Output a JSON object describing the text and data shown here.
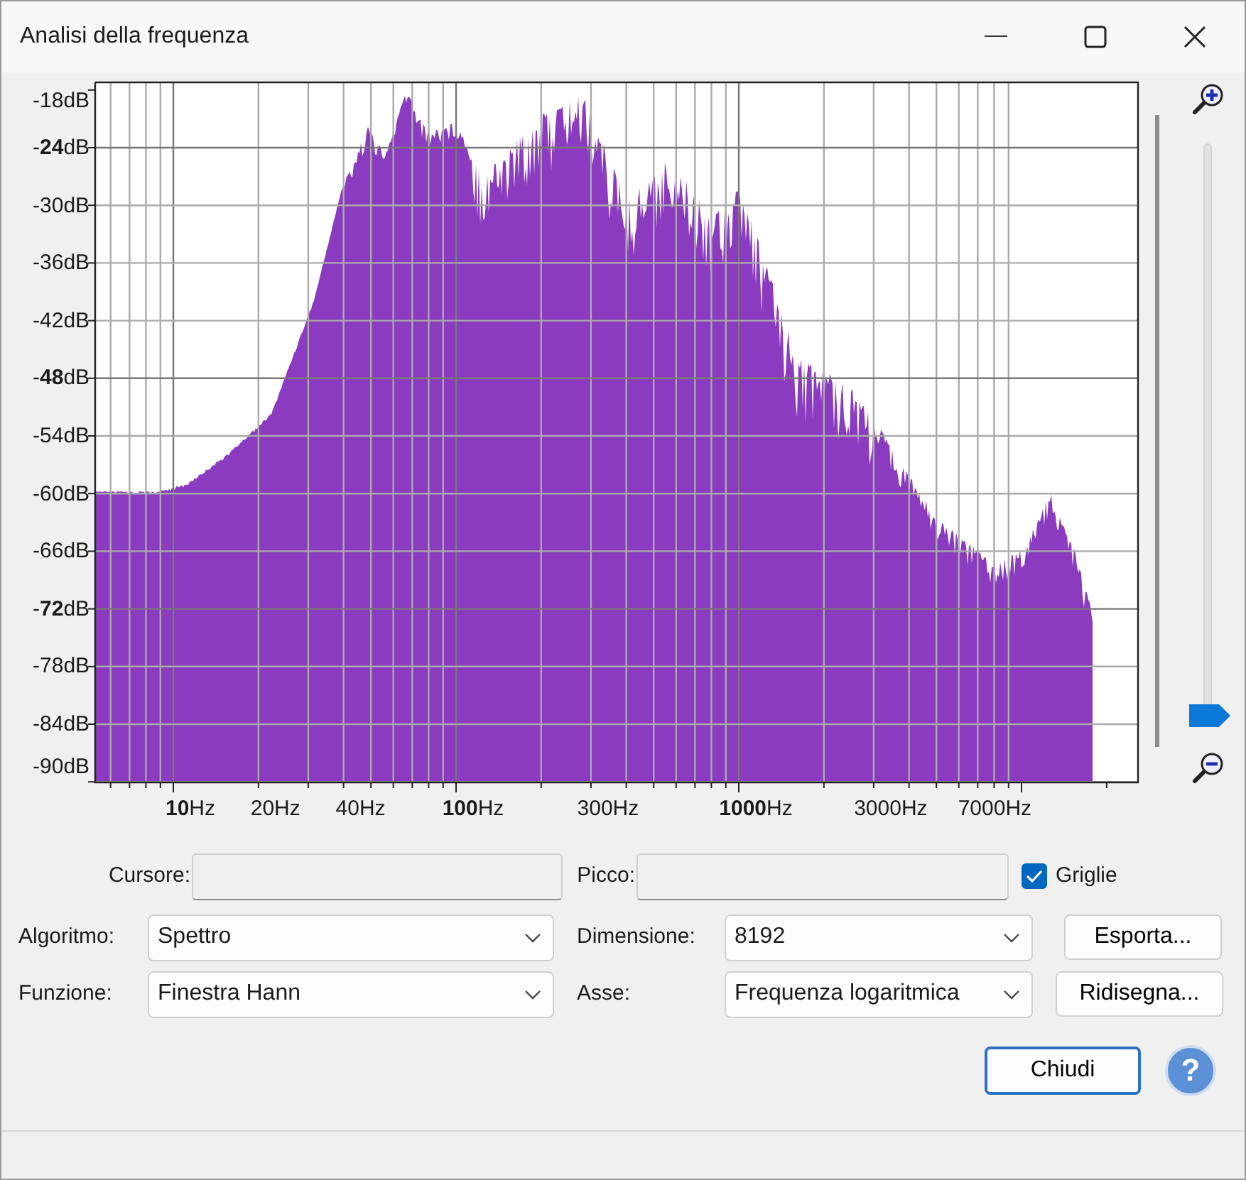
{
  "window": {
    "title": "Analisi della frequenza"
  },
  "spectrum": {
    "y_labels": [
      "-18dB",
      "-**24**dB",
      "-30dB",
      "-36dB",
      "-42dB",
      "-**48**dB",
      "-54dB",
      "-60dB",
      "-66dB",
      "-**72**dB",
      "-78dB",
      "-84dB",
      "-90dB"
    ],
    "x_labels": [
      "**10**Hz",
      "20Hz",
      "40Hz",
      "**100**Hz",
      "300Hz",
      "**1000**Hz",
      "3000Hz",
      "7000Hz"
    ]
  },
  "zoom_slider": {
    "level": 0
  },
  "cursor_field": {
    "label": "Cursore:"
  },
  "peak_field": {
    "label": "Picco:"
  },
  "grid_checkbox": {
    "label": "Griglie",
    "checked": true
  },
  "algorithm": {
    "label": "Algoritmo:",
    "value": "Spettro"
  },
  "size": {
    "label": "Dimensione:",
    "value": "8192"
  },
  "export_button": "Esporta...",
  "function": {
    "label": "Funzione:",
    "value": "Finestra Hann"
  },
  "axis": {
    "label": "Asse:",
    "value": "Frequenza logaritmica"
  },
  "redraw_button": "Ridisegna...",
  "close_button": "Chiudi",
  "help_button": "?"
}
